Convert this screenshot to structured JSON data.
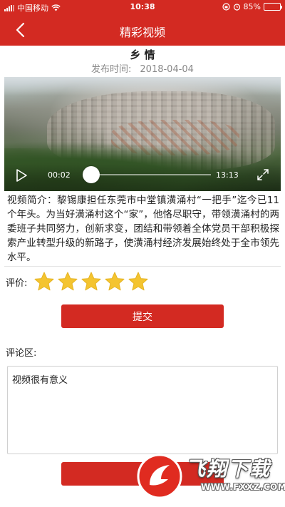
{
  "status_bar": {
    "carrier": "中国移动",
    "time": "10:38",
    "battery_percent": "85%",
    "battery_level": 0.85
  },
  "nav": {
    "back_icon": "chevron-left-icon",
    "title": "精彩视频"
  },
  "article": {
    "title": "乡 情",
    "publish_label": "发布时间:",
    "publish_date": "2018-04-04"
  },
  "video": {
    "current_time": "00:02",
    "total_time": "13:13",
    "progress": 0.0025,
    "play_icon": "play-icon",
    "fullscreen_icon": "fullscreen-icon"
  },
  "description": "视频简介：黎锡康担任东莞市中堂镇潢涌村“一把手”迄今已11个年头。为当好潢涌村这个“家”，他恪尽职守，带领潢涌村的两委班子共同努力，创新求变，团结和带领着全体党员干部积极探索产业转型升级的新路子，使潢涌村经济发展始终处于全市领先水平。",
  "rating": {
    "label": "评价:",
    "stars": 5,
    "max_stars": 5,
    "star_color": "#f4c430"
  },
  "submit_label": "提交",
  "comments": {
    "label": "评论区:",
    "value": "视频很有意义"
  },
  "colors": {
    "brand_red": "#d32a22"
  },
  "watermark": {
    "text": "飞翔下载",
    "url": "WWW.FXXZ.COM"
  }
}
